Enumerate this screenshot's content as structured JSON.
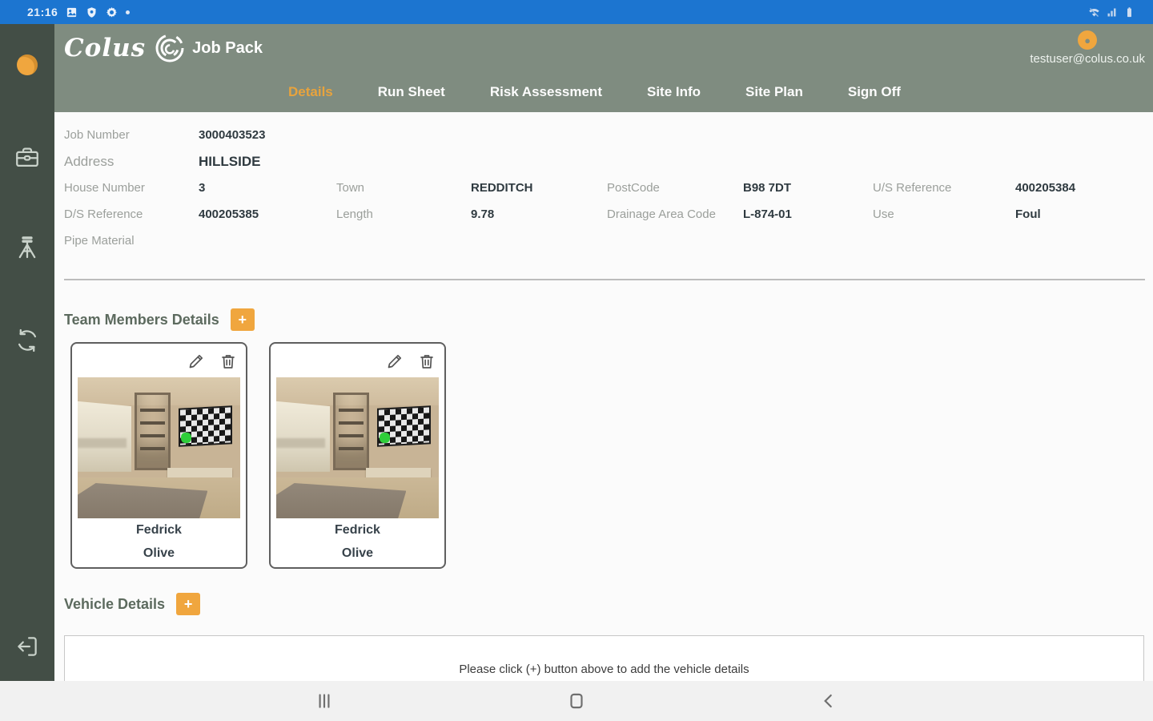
{
  "status_bar": {
    "time": "21:16"
  },
  "sidebar": {
    "icons": [
      "user-status-dot",
      "briefcase-icon",
      "tripod-icon",
      "sync-icon",
      "logout-icon"
    ]
  },
  "header": {
    "logo": "Colus",
    "title": "Job Pack",
    "email": "testuser@colus.co.uk"
  },
  "tabs": [
    {
      "label": "Details",
      "active": true
    },
    {
      "label": "Run Sheet",
      "active": false
    },
    {
      "label": "Risk Assessment",
      "active": false
    },
    {
      "label": "Site Info",
      "active": false
    },
    {
      "label": "Site Plan",
      "active": false
    },
    {
      "label": "Sign Off",
      "active": false
    }
  ],
  "details": {
    "job_number_label": "Job Number",
    "job_number": "3000403523",
    "address_label": "Address",
    "address": "HILLSIDE",
    "house_number_label": "House Number",
    "house_number": "3",
    "town_label": "Town",
    "town": "REDDITCH",
    "postcode_label": "PostCode",
    "postcode": "B98 7DT",
    "us_reference_label": "U/S Reference",
    "us_reference": "400205384",
    "ds_reference_label": "D/S Reference",
    "ds_reference": "400205385",
    "length_label": "Length",
    "length": "9.78",
    "drainage_label": "Drainage Area Code",
    "drainage": "L-874-01",
    "use_label": "Use",
    "use": "Foul",
    "pipe_material_label": "Pipe Material",
    "pipe_material": ""
  },
  "team": {
    "title": "Team Members Details",
    "add_label": "+",
    "cards": [
      {
        "first": "Fedrick",
        "last": "Olive"
      },
      {
        "first": "Fedrick",
        "last": "Olive"
      }
    ]
  },
  "vehicle": {
    "title": "Vehicle Details",
    "add_label": "+",
    "empty_message": "Please click (+) button above to add the vehicle details"
  },
  "colors": {
    "status_blue": "#1c75d0",
    "sidebar_green": "#434e46",
    "header_green": "#7f8c80",
    "accent_orange": "#f0a63e",
    "active_tab_orange": "#e8a33d",
    "highlight_green": "#2fce3a"
  }
}
